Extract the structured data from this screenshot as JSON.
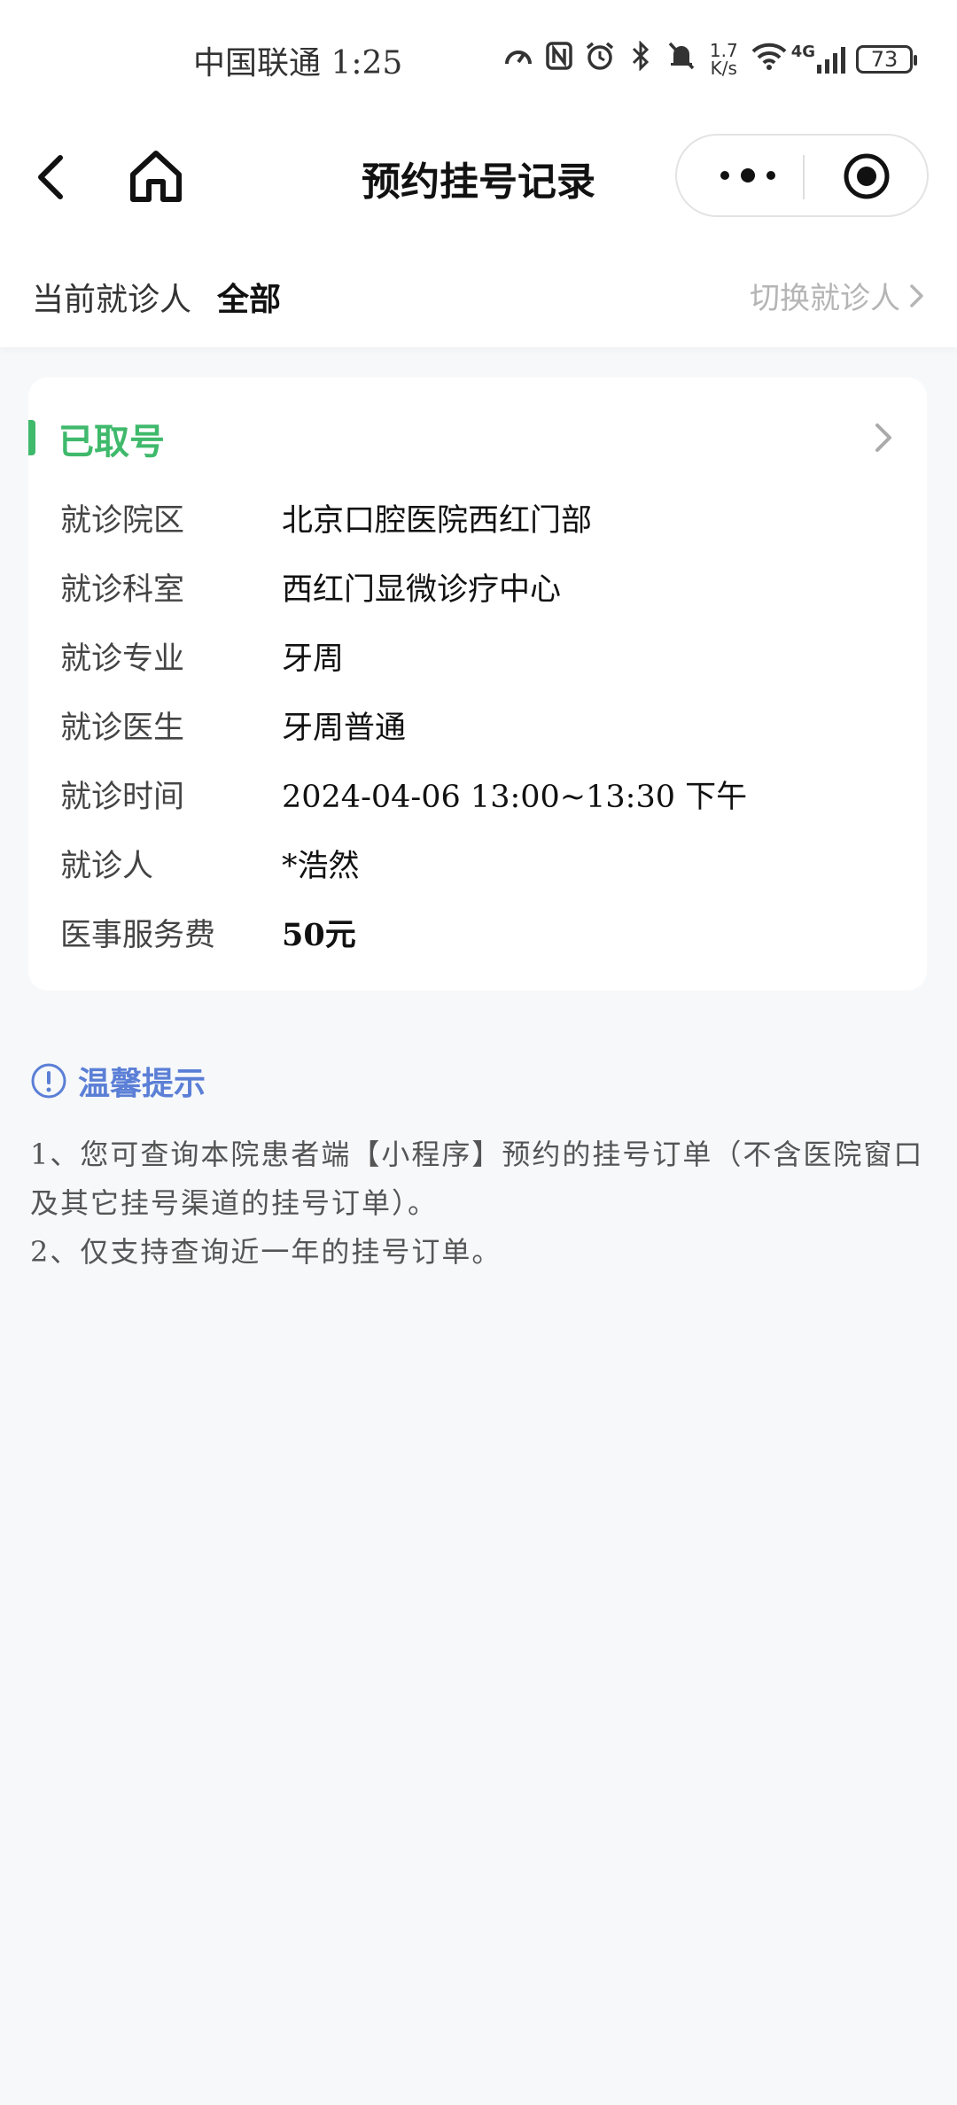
{
  "status_bar": {
    "carrier_time": "中国联通 1:25",
    "net_speed_value": "1.7",
    "net_speed_unit": "K/s",
    "network": "4G",
    "battery": "73"
  },
  "nav": {
    "title": "预约挂号记录"
  },
  "patient": {
    "label": "当前就诊人",
    "value": "全部",
    "switch_label": "切换就诊人"
  },
  "record": {
    "status": "已取号",
    "status_color": "#3fb96b",
    "fields": [
      {
        "label": "就诊院区",
        "value": "北京口腔医院西红门部"
      },
      {
        "label": "就诊科室",
        "value": "西红门显微诊疗中心"
      },
      {
        "label": "就诊专业",
        "value": "牙周"
      },
      {
        "label": "就诊医生",
        "value": "牙周普通"
      },
      {
        "label": "就诊时间",
        "value": "2024-04-06 13:00~13:30 下午"
      },
      {
        "label": "就诊人",
        "value": "*浩然"
      },
      {
        "label": "医事服务费",
        "value": "50元"
      }
    ]
  },
  "tips": {
    "title": "温馨提示",
    "accent_color": "#5b7fd6",
    "lines": [
      "1、您可查询本院患者端【小程序】预约的挂号订单（不含医院窗口及其它挂号渠道的挂号订单）。",
      "2、仅支持查询近一年的挂号订单。"
    ]
  }
}
